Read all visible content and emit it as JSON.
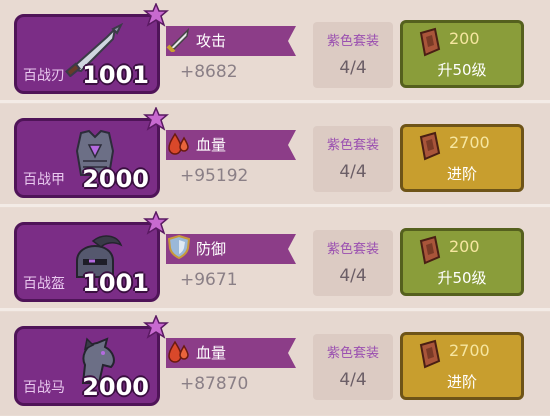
{
  "rows": [
    {
      "equip_name": "百战刃",
      "equip_level": "1001",
      "equip_icon": "blade-icon",
      "stat_icon": "sword-icon",
      "stat_name": "攻击",
      "stat_value": "+8682",
      "set_label": "紫色套装",
      "set_count": "4/4",
      "cost": "200",
      "action_label": "升50级",
      "action_style": "green"
    },
    {
      "equip_name": "百战甲",
      "equip_level": "2000",
      "equip_icon": "armor-icon",
      "stat_icon": "blood-drop-icon",
      "stat_name": "血量",
      "stat_value": "+95192",
      "set_label": "紫色套装",
      "set_count": "4/4",
      "cost": "2700",
      "action_label": "进阶",
      "action_style": "gold"
    },
    {
      "equip_name": "百战盔",
      "equip_level": "1001",
      "equip_icon": "helmet-icon",
      "stat_icon": "shield-icon",
      "stat_name": "防御",
      "stat_value": "+9671",
      "set_label": "紫色套装",
      "set_count": "4/4",
      "cost": "200",
      "action_label": "升50级",
      "action_style": "green"
    },
    {
      "equip_name": "百战马",
      "equip_level": "2000",
      "equip_icon": "horse-icon",
      "stat_icon": "blood-drop-icon",
      "stat_name": "血量",
      "stat_value": "+87870",
      "set_label": "紫色套装",
      "set_count": "4/4",
      "cost": "2700",
      "action_label": "进阶",
      "action_style": "gold"
    }
  ],
  "colors": {
    "card_purple": "#7b2d86",
    "banner_purple": "#8c3d88",
    "set_purple": "#9a4fb0",
    "button_green": "#8a9d3a",
    "button_gold": "#c89e2e"
  }
}
